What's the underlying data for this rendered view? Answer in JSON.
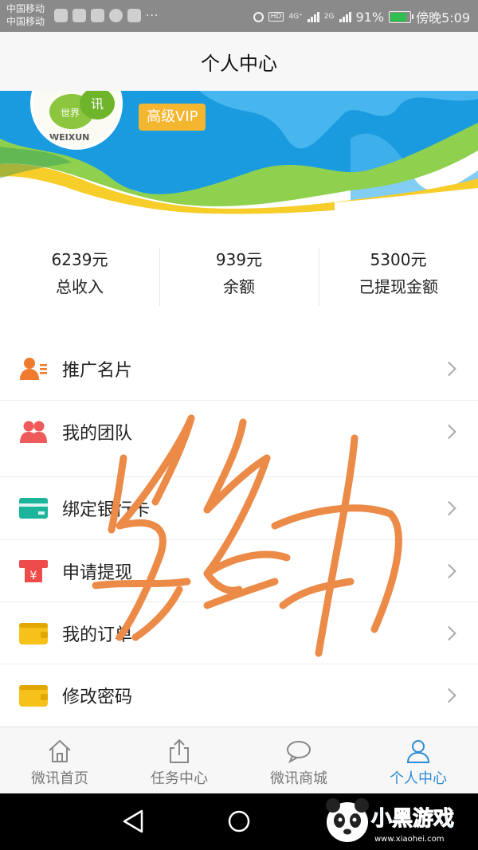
{
  "status_bar": {
    "carrier_1": "中国移动",
    "carrier_2": "中国移动",
    "dots": "···",
    "hd": "HD",
    "net_4g": "4G⁺",
    "net_2g": "2G",
    "battery": "91%",
    "time": "傍晚5:09",
    "battery_level": 0.91
  },
  "header": {
    "title": "个人中心"
  },
  "profile": {
    "avatar_text_1": "世界",
    "avatar_text_2": "WEIXUN",
    "vip_label": "高级VIP"
  },
  "stats": [
    {
      "value": "6239元",
      "label": "总收入"
    },
    {
      "value": "939元",
      "label": "余额"
    },
    {
      "value": "5300元",
      "label": "己提现金额"
    }
  ],
  "menu": [
    {
      "label": "推广名片",
      "icon": "business-card-icon",
      "color": "#f07a2e"
    },
    {
      "label": "我的团队",
      "icon": "team-icon",
      "color": "#ef5a5a"
    },
    {
      "label": "绑定银行卡",
      "icon": "bank-card-icon",
      "color": "#1cb59b"
    },
    {
      "label": "申请提现",
      "icon": "withdraw-icon",
      "color": "#ee4b4b"
    },
    {
      "label": "我的订单",
      "icon": "order-wallet-icon",
      "color": "#f6c21a"
    },
    {
      "label": "修改密码",
      "icon": "password-wallet-icon",
      "color": "#f6c21a"
    }
  ],
  "bottom_nav": [
    {
      "label": "微讯首页",
      "icon": "home-icon"
    },
    {
      "label": "任务中心",
      "icon": "share-upload-icon"
    },
    {
      "label": "微讯商城",
      "icon": "chat-bubble-icon"
    },
    {
      "label": "个人中心",
      "icon": "person-icon"
    }
  ],
  "watermark": {
    "text_1": "小黑游戏",
    "text_2": "www.xiaohei.com"
  },
  "colors": {
    "accent": "#2a8bd6",
    "vip": "#f4b52f",
    "banner_blue": "#1a9be0",
    "scribble": "#ec8a47"
  }
}
